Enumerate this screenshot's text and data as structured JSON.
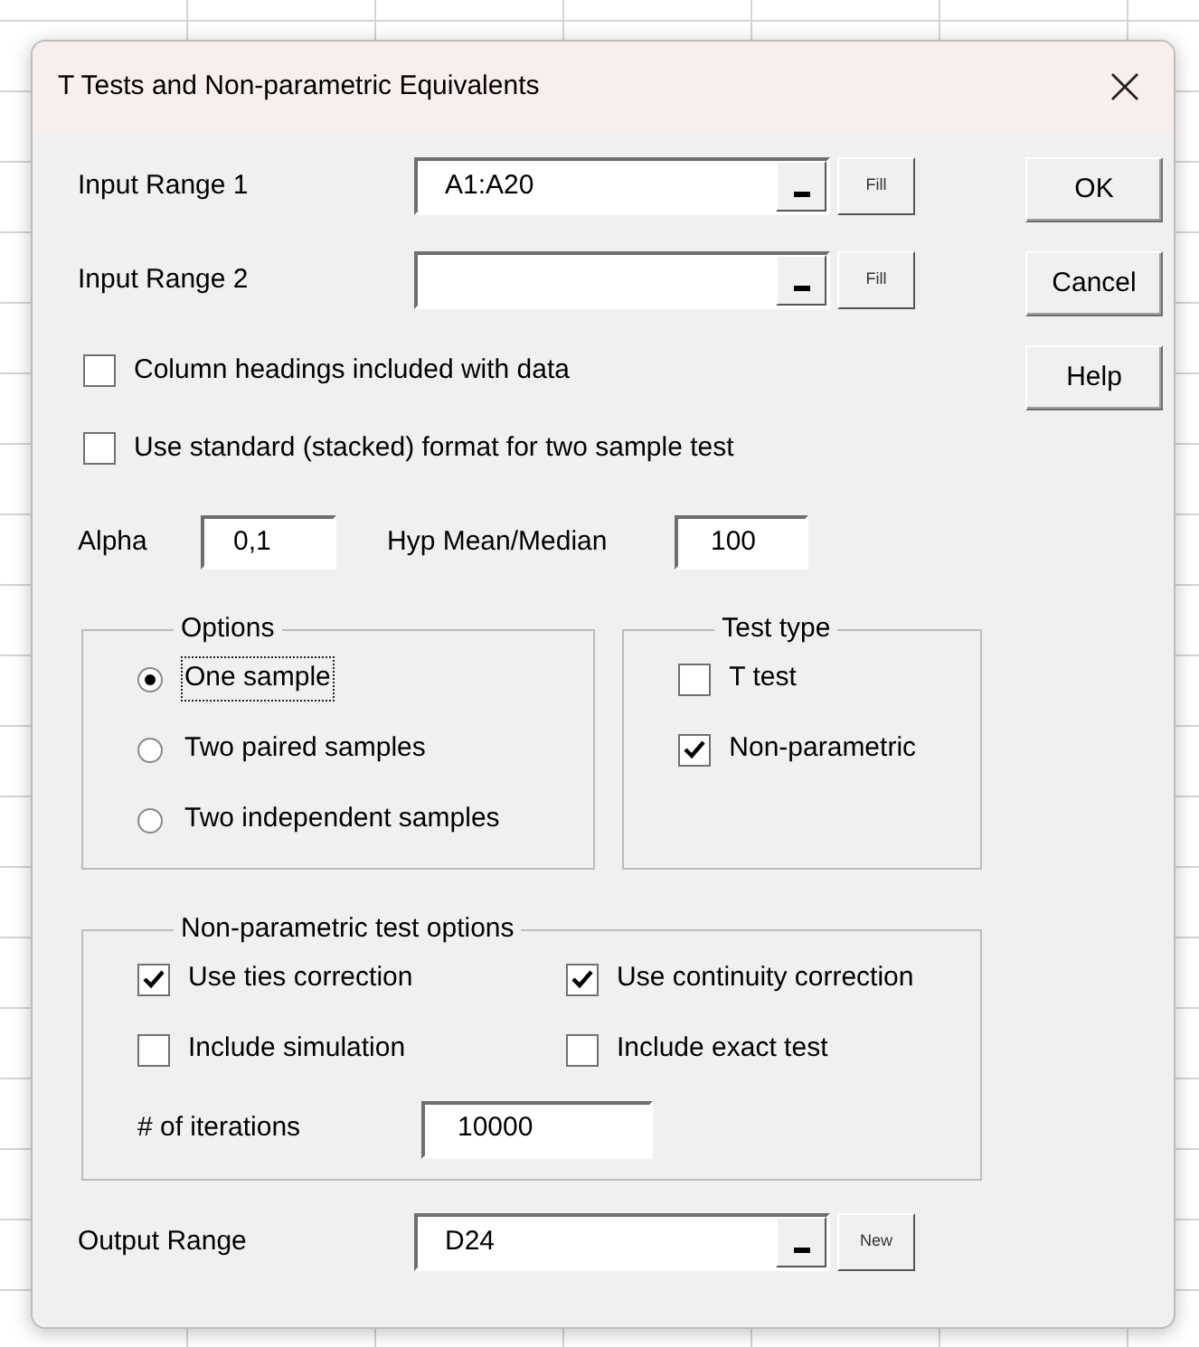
{
  "window": {
    "title": "T Tests and Non-parametric Equivalents"
  },
  "range_rows": [
    {
      "label": "Input Range 1",
      "value": "A1:A20",
      "button": "Fill"
    },
    {
      "label": "Input Range 2",
      "button": "Fill"
    }
  ],
  "buttons": [
    "OK",
    "Cancel",
    "Help"
  ],
  "checkboxes": [
    {
      "label": "Column headings included with data",
      "checked": false
    },
    {
      "label": "Use standard (stacked) format for two sample test",
      "checked": false
    }
  ],
  "alpha": {
    "label": "Alpha",
    "value": "0,1"
  },
  "hyp_mean": {
    "label": "Hyp Mean/Median",
    "value": "100"
  },
  "options": {
    "title": "Options",
    "items": [
      {
        "label": "One sample",
        "selected": true,
        "focused": true
      },
      {
        "label": "Two paired samples",
        "selected": false,
        "focused": false
      },
      {
        "label": "Two independent samples",
        "selected": false,
        "focused": false
      }
    ]
  },
  "test_type": {
    "title": "Test type",
    "items": [
      {
        "label": "T test",
        "checked": false
      },
      {
        "label": "Non-parametric",
        "checked": true
      }
    ]
  },
  "nonparametric": {
    "title": "Non-parametric test options",
    "items": [
      {
        "label": "Use ties correction",
        "checked": true
      },
      {
        "label": "Use continuity correction",
        "checked": true
      },
      {
        "label": "Include simulation",
        "checked": false
      },
      {
        "label": "Include exact test",
        "checked": false
      }
    ],
    "iterations": {
      "label": "# of iterations",
      "value": "10000"
    }
  },
  "output_range": {
    "label": "Output Range",
    "value": "D24",
    "button": "New"
  }
}
